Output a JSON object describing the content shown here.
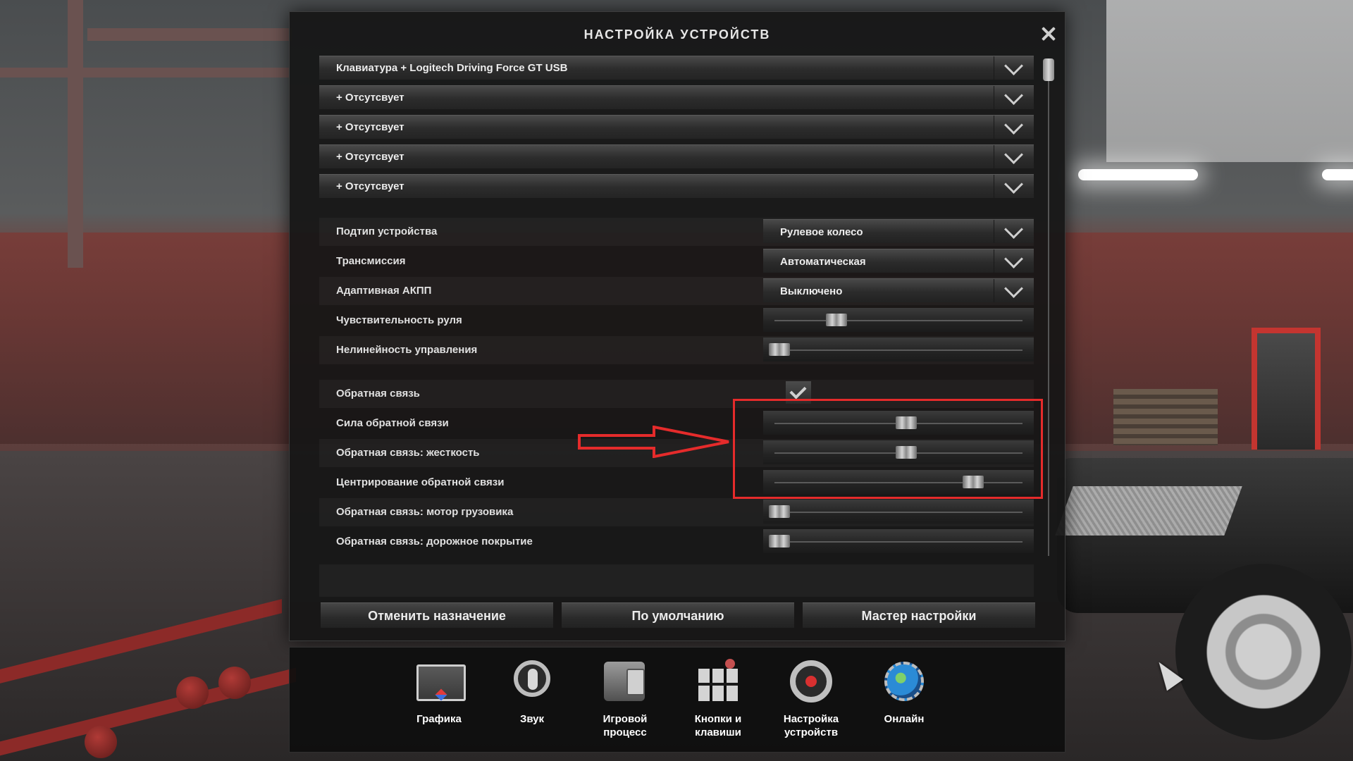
{
  "dialog": {
    "title": "НАСТРОЙКА УСТРОЙСТВ"
  },
  "devices": [
    {
      "label": "Клавиатура + Logitech Driving Force GT USB"
    },
    {
      "label": "+ Отсутсвует"
    },
    {
      "label": "+ Отсутсвует"
    },
    {
      "label": "+ Отсутсвует"
    },
    {
      "label": "+ Отсутсвует"
    }
  ],
  "settings": {
    "device_subtype": {
      "label": "Подтип устройства",
      "value": "Рулевое колесо"
    },
    "transmission": {
      "label": "Трансмиссия",
      "value": "Автоматическая"
    },
    "adaptive_gearbox": {
      "label": "Адаптивная АКПП",
      "value": "Выключено"
    },
    "steering_sensitivity": {
      "label": "Чувствительность руля",
      "level": 0.25
    },
    "steering_nonlinearity": {
      "label": "Нелинейность управления",
      "level": 0.02
    },
    "force_feedback": {
      "label": "Обратная связь",
      "checked": true
    },
    "ff_strength": {
      "label": "Сила обратной связи",
      "level": 0.53
    },
    "ff_stiffness": {
      "label": "Обратная связь: жесткость",
      "level": 0.53
    },
    "ff_centering": {
      "label": "Центрирование обратной связи",
      "level": 0.8
    },
    "ff_engine": {
      "label": "Обратная связь: мотор грузовика",
      "level": 0.02
    },
    "ff_road": {
      "label": "Обратная связь: дорожное покрытие",
      "level": 0.02
    }
  },
  "buttons": {
    "unassign": "Отменить назначение",
    "defaults": "По умолчанию",
    "wizard": "Мастер настройки"
  },
  "menu": [
    {
      "label": "Графика",
      "icon": "monitor-icon"
    },
    {
      "label": "Звук",
      "icon": "speaker-icon"
    },
    {
      "label": "Игровой процесс",
      "icon": "truck-phone-icon"
    },
    {
      "label": "Кнопки и клавиши",
      "icon": "keys-icon"
    },
    {
      "label": "Настройка устройств",
      "icon": "steering-wheel-icon"
    },
    {
      "label": "Онлайн",
      "icon": "globe-icon"
    }
  ],
  "colors": {
    "annotation_red": "#e52b2b",
    "panel_bg": "#161616",
    "text": "#ededed"
  }
}
